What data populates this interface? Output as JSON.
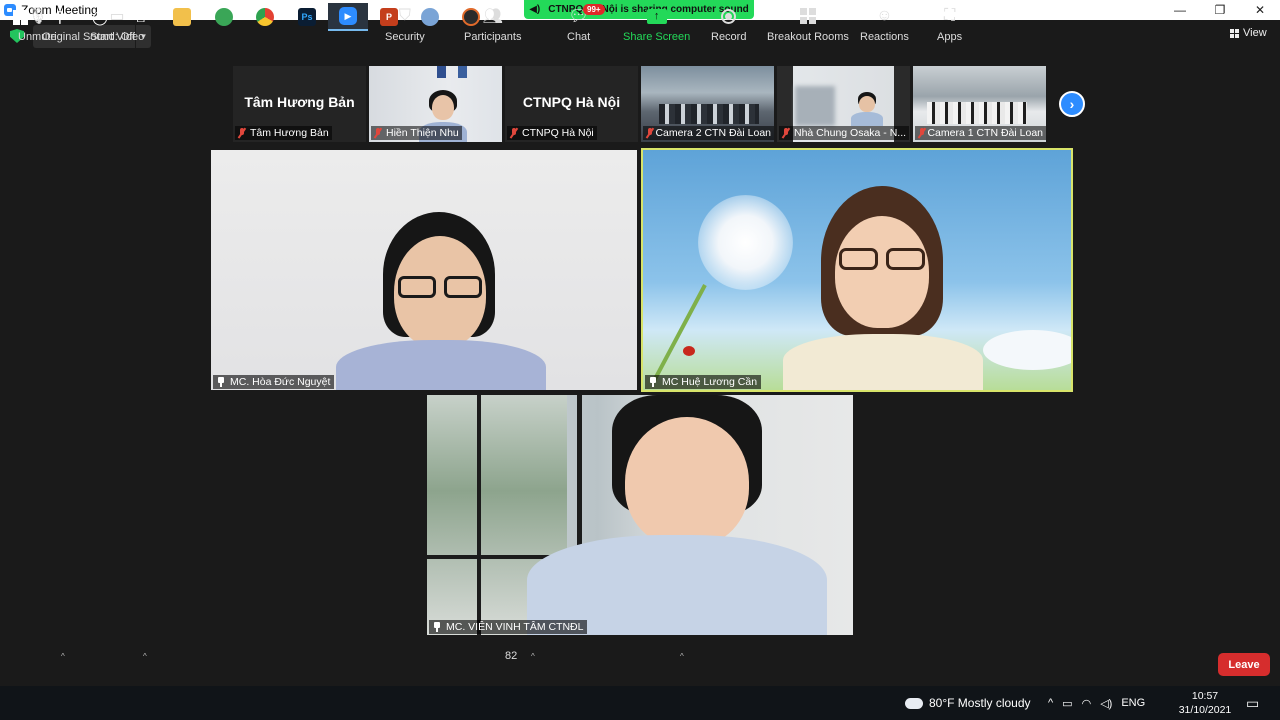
{
  "window": {
    "title": "Zoom Meeting"
  },
  "window_controls": {
    "minimize": "—",
    "maximize": "❐",
    "close": "✕"
  },
  "share_banner": {
    "text": "CTNPQ Hà Nội is sharing computer sound"
  },
  "top_bar": {
    "original_sound": "Original Sound: Off",
    "view_label": "View"
  },
  "thumbnails": [
    {
      "big_name": "Tâm Hương Bản",
      "label": "Tâm Hương Bản"
    },
    {
      "big_name": "",
      "label": "Hiền Thiện Nhu"
    },
    {
      "big_name": "CTNPQ Hà Nội",
      "label": "CTNPQ Hà Nội"
    },
    {
      "big_name": "",
      "label": "Camera 2 CTN Đài Loan"
    },
    {
      "big_name": "",
      "label": "Nhà Chung Osaka - N..."
    },
    {
      "big_name": "",
      "label": "Camera 1 CTN Đài Loan"
    }
  ],
  "tiles": [
    {
      "label": "MC. Hòa Đức Nguyệt"
    },
    {
      "label": "MC Huệ Lương Cần"
    },
    {
      "label": "MC. VIÊN VINH TÂM CTNĐL"
    }
  ],
  "toolbar": {
    "unmute": "Unmute",
    "start_video": "Start Video",
    "security": "Security",
    "participants": "Participants",
    "participants_count": "82",
    "chat": "Chat",
    "chat_badge": "99+",
    "share_screen": "Share Screen",
    "record": "Record",
    "breakout_rooms": "Breakout Rooms",
    "reactions": "Reactions",
    "apps": "Apps",
    "leave": "Leave"
  },
  "taskbar": {
    "weather": "80°F  Mostly cloudy",
    "language": "ENG",
    "time": "10:57",
    "date": "31/10/2021"
  },
  "colors": {
    "zoom_blue": "#2d8cff",
    "share_green": "#23d959",
    "leave_red": "#d62d2d",
    "active_speaker": "#d8e46a"
  }
}
